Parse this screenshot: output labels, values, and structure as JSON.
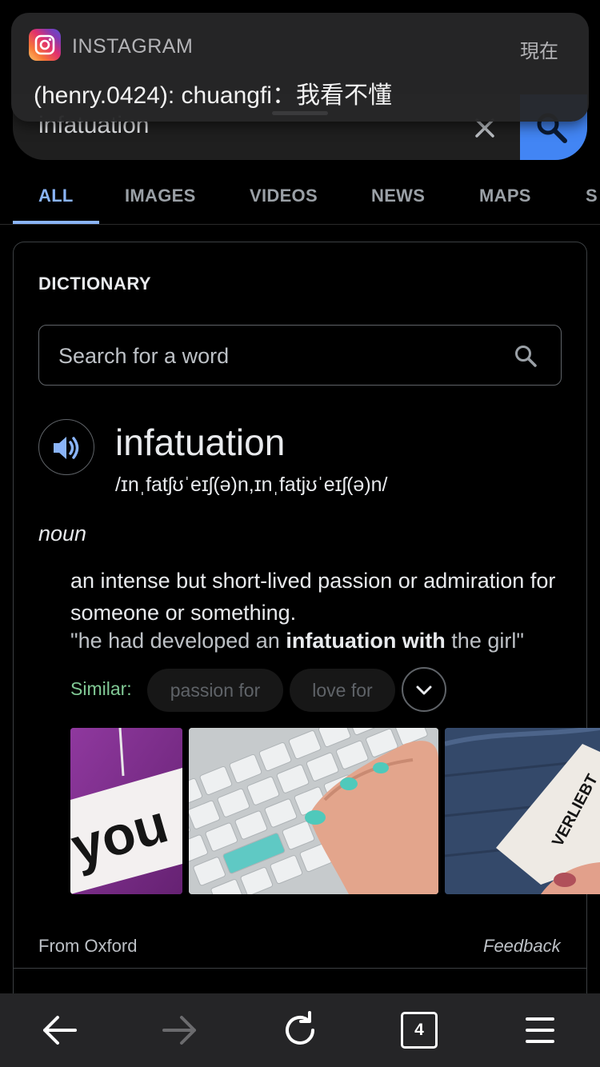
{
  "notification": {
    "app_name": "INSTAGRAM",
    "time": "現在",
    "message": "(henry.0424): chuangfi：我看不懂"
  },
  "search": {
    "query": "infatuation"
  },
  "tabs": [
    {
      "label": "ALL",
      "active": true
    },
    {
      "label": "IMAGES"
    },
    {
      "label": "VIDEOS"
    },
    {
      "label": "NEWS"
    },
    {
      "label": "MAPS"
    },
    {
      "label": "S"
    }
  ],
  "dictionary": {
    "title": "DICTIONARY",
    "search_placeholder": "Search for a word",
    "headword": "infatuation",
    "phonetic": "/ɪnˌfatʃʊˈeɪʃ(ə)n,ɪnˌfatjʊˈeɪʃ(ə)n/",
    "part_of_speech": "noun",
    "definition": "an intense but short-lived passion or admiration for someone or something.",
    "example": {
      "before": "\"he had developed an ",
      "bold": "infatuation with",
      "after": " the girl\""
    },
    "similar_label": "Similar:",
    "similar": [
      "passion for",
      "love for"
    ],
    "images": [
      {
        "caption_text": "you"
      },
      {
        "caption_text": ""
      },
      {
        "caption_text": "VERLIEBT"
      }
    ],
    "source": "From Oxford",
    "feedback": "Feedback"
  },
  "toolbar": {
    "tab_count": "4"
  },
  "colors": {
    "accent": "#8ab4f8",
    "search_button": "#4285f4",
    "similar_label": "#81c995"
  }
}
